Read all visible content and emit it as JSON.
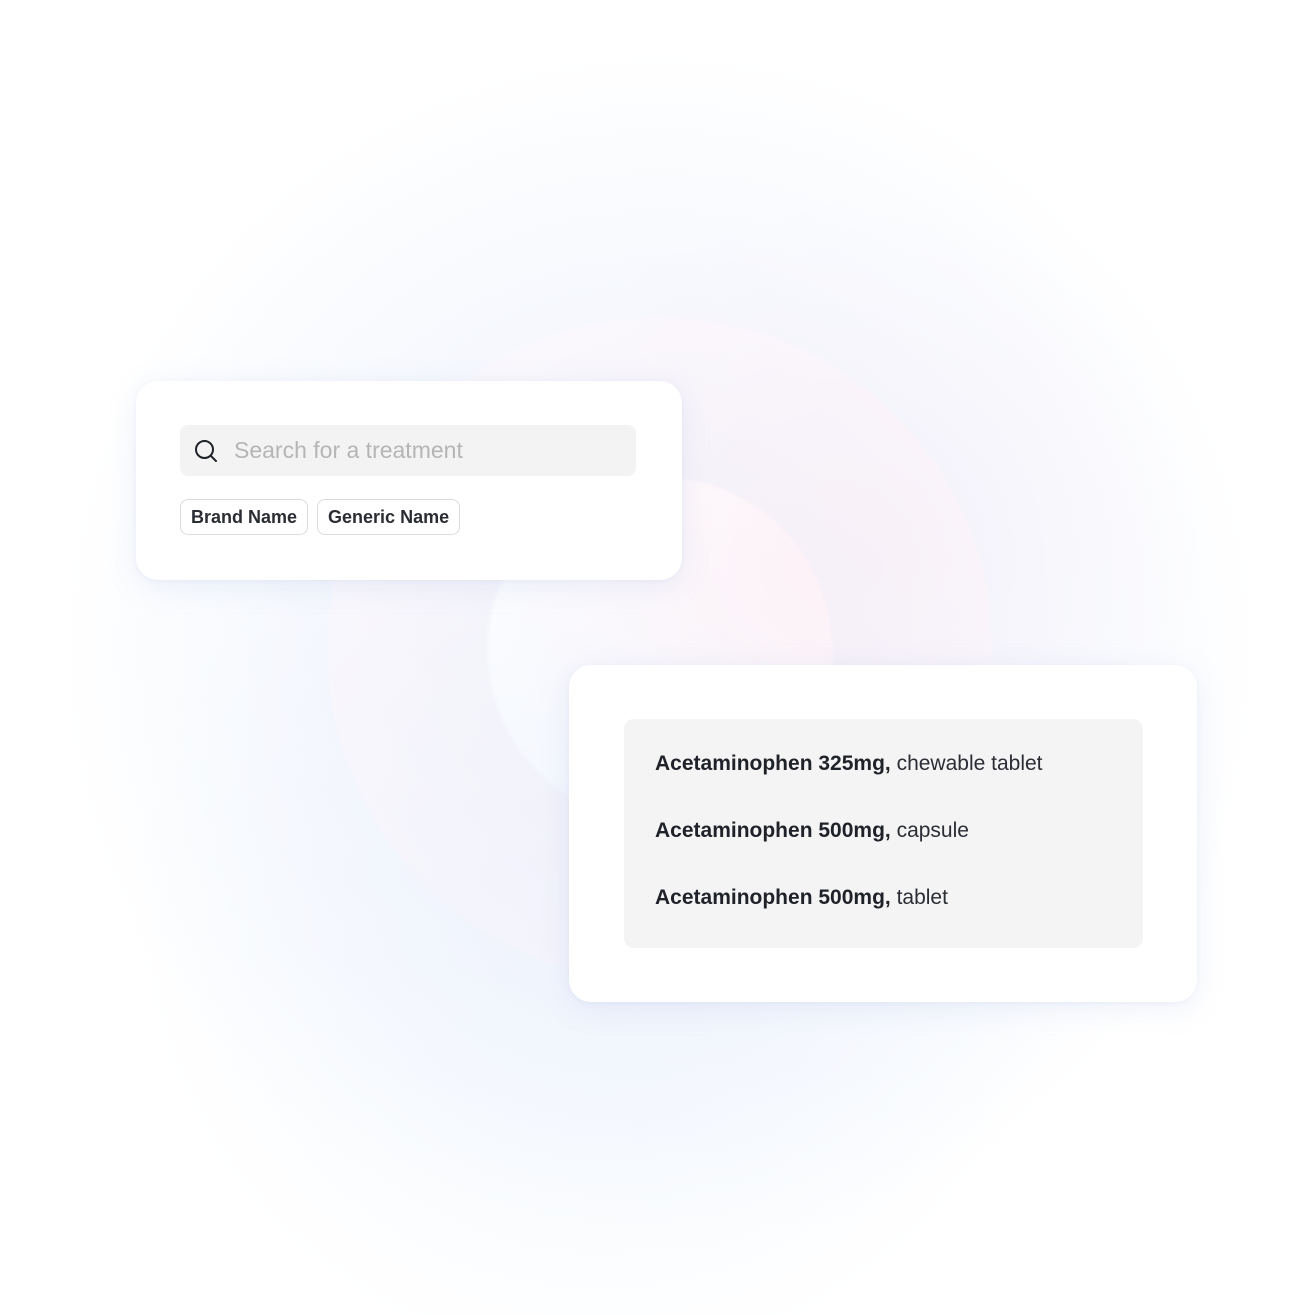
{
  "search": {
    "placeholder": "Search for a treatment",
    "value": "",
    "icon": "search-icon"
  },
  "filters": [
    {
      "label": "Brand Name"
    },
    {
      "label": "Generic Name"
    }
  ],
  "results": [
    {
      "name": "Acetaminophen 325mg,",
      "form": "chewable tablet"
    },
    {
      "name": "Acetaminophen 500mg,",
      "form": "capsule"
    },
    {
      "name": "Acetaminophen 500mg,",
      "form": "tablet"
    }
  ],
  "colors": {
    "text_primary": "#1f2228",
    "placeholder": "#b5b5b5",
    "field_background": "#f3f3f3",
    "chip_border": "#dcdcdc"
  }
}
